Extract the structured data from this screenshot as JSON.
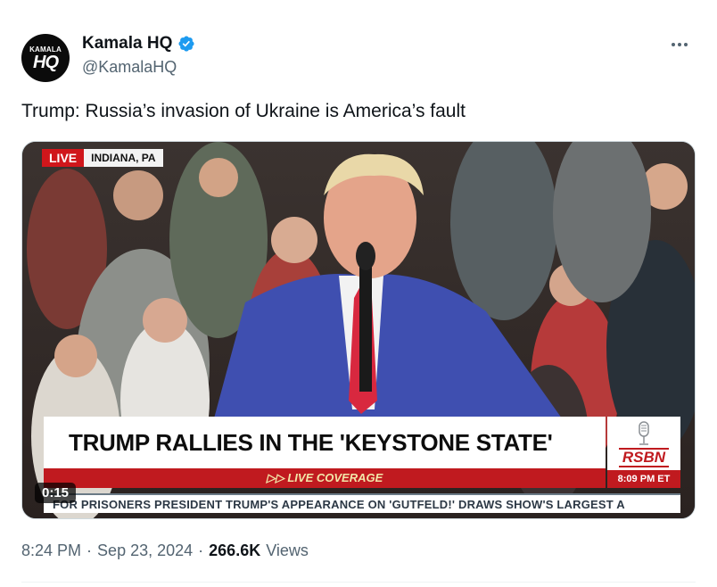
{
  "author": {
    "display_name": "Kamala HQ",
    "handle": "@KamalaHQ",
    "avatar_top": "KAMALA",
    "avatar_main": "HQ",
    "verified": true,
    "verified_color": "#1d9bf0"
  },
  "tweet": {
    "text": "Trump: Russia’s invasion of Ukraine is America’s fault"
  },
  "media": {
    "live_label": "LIVE",
    "location": "INDIANA, PA",
    "headline": "TRUMP RALLIES IN THE 'KEYSTONE STATE'",
    "bar_label": "▷▷ LIVE COVERAGE",
    "network": "RSBN",
    "network_time": "8:09 PM ET",
    "ticker": "FOR PRISONERS     PRESIDENT TRUMP'S APPEARANCE ON 'GUTFELD!' DRAWS SHOW'S LARGEST A",
    "duration": "0:15",
    "accent_red": "#c01a1f"
  },
  "meta": {
    "time": "8:24 PM",
    "date": "Sep 23, 2024",
    "views_count": "266.6K",
    "views_label": "Views",
    "separator": "·"
  },
  "icons": {
    "verified": "verified-badge-icon",
    "more": "more-horizontal-icon",
    "mic": "microphone-icon"
  }
}
